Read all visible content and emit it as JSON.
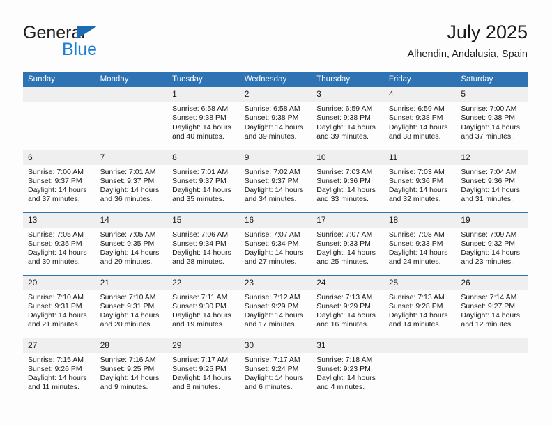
{
  "brand": {
    "line1": "General",
    "line2": "Blue",
    "triangle_color": "#1b6cb0",
    "line2_color": "#1b7ed6"
  },
  "header": {
    "title": "July 2025",
    "location": "Alhendin, Andalusia, Spain"
  },
  "theme": {
    "header_bg": "#2e74b5",
    "daynum_bg": "#efefef",
    "text": "#1a1a1a",
    "page_bg": "#fdfdfd"
  },
  "weekdays": [
    "Sunday",
    "Monday",
    "Tuesday",
    "Wednesday",
    "Thursday",
    "Friday",
    "Saturday"
  ],
  "labels": {
    "sunrise_prefix": "Sunrise:",
    "sunset_prefix": "Sunset:",
    "daylight_prefix": "Daylight:"
  },
  "weeks": [
    [
      {
        "day": "",
        "sunrise": "",
        "sunset": "",
        "daylight": ""
      },
      {
        "day": "",
        "sunrise": "",
        "sunset": "",
        "daylight": ""
      },
      {
        "day": "1",
        "sunrise": "Sunrise: 6:58 AM",
        "sunset": "Sunset: 9:38 PM",
        "daylight": "Daylight: 14 hours and 40 minutes."
      },
      {
        "day": "2",
        "sunrise": "Sunrise: 6:58 AM",
        "sunset": "Sunset: 9:38 PM",
        "daylight": "Daylight: 14 hours and 39 minutes."
      },
      {
        "day": "3",
        "sunrise": "Sunrise: 6:59 AM",
        "sunset": "Sunset: 9:38 PM",
        "daylight": "Daylight: 14 hours and 39 minutes."
      },
      {
        "day": "4",
        "sunrise": "Sunrise: 6:59 AM",
        "sunset": "Sunset: 9:38 PM",
        "daylight": "Daylight: 14 hours and 38 minutes."
      },
      {
        "day": "5",
        "sunrise": "Sunrise: 7:00 AM",
        "sunset": "Sunset: 9:38 PM",
        "daylight": "Daylight: 14 hours and 37 minutes."
      }
    ],
    [
      {
        "day": "6",
        "sunrise": "Sunrise: 7:00 AM",
        "sunset": "Sunset: 9:37 PM",
        "daylight": "Daylight: 14 hours and 37 minutes."
      },
      {
        "day": "7",
        "sunrise": "Sunrise: 7:01 AM",
        "sunset": "Sunset: 9:37 PM",
        "daylight": "Daylight: 14 hours and 36 minutes."
      },
      {
        "day": "8",
        "sunrise": "Sunrise: 7:01 AM",
        "sunset": "Sunset: 9:37 PM",
        "daylight": "Daylight: 14 hours and 35 minutes."
      },
      {
        "day": "9",
        "sunrise": "Sunrise: 7:02 AM",
        "sunset": "Sunset: 9:37 PM",
        "daylight": "Daylight: 14 hours and 34 minutes."
      },
      {
        "day": "10",
        "sunrise": "Sunrise: 7:03 AM",
        "sunset": "Sunset: 9:36 PM",
        "daylight": "Daylight: 14 hours and 33 minutes."
      },
      {
        "day": "11",
        "sunrise": "Sunrise: 7:03 AM",
        "sunset": "Sunset: 9:36 PM",
        "daylight": "Daylight: 14 hours and 32 minutes."
      },
      {
        "day": "12",
        "sunrise": "Sunrise: 7:04 AM",
        "sunset": "Sunset: 9:36 PM",
        "daylight": "Daylight: 14 hours and 31 minutes."
      }
    ],
    [
      {
        "day": "13",
        "sunrise": "Sunrise: 7:05 AM",
        "sunset": "Sunset: 9:35 PM",
        "daylight": "Daylight: 14 hours and 30 minutes."
      },
      {
        "day": "14",
        "sunrise": "Sunrise: 7:05 AM",
        "sunset": "Sunset: 9:35 PM",
        "daylight": "Daylight: 14 hours and 29 minutes."
      },
      {
        "day": "15",
        "sunrise": "Sunrise: 7:06 AM",
        "sunset": "Sunset: 9:34 PM",
        "daylight": "Daylight: 14 hours and 28 minutes."
      },
      {
        "day": "16",
        "sunrise": "Sunrise: 7:07 AM",
        "sunset": "Sunset: 9:34 PM",
        "daylight": "Daylight: 14 hours and 27 minutes."
      },
      {
        "day": "17",
        "sunrise": "Sunrise: 7:07 AM",
        "sunset": "Sunset: 9:33 PM",
        "daylight": "Daylight: 14 hours and 25 minutes."
      },
      {
        "day": "18",
        "sunrise": "Sunrise: 7:08 AM",
        "sunset": "Sunset: 9:33 PM",
        "daylight": "Daylight: 14 hours and 24 minutes."
      },
      {
        "day": "19",
        "sunrise": "Sunrise: 7:09 AM",
        "sunset": "Sunset: 9:32 PM",
        "daylight": "Daylight: 14 hours and 23 minutes."
      }
    ],
    [
      {
        "day": "20",
        "sunrise": "Sunrise: 7:10 AM",
        "sunset": "Sunset: 9:31 PM",
        "daylight": "Daylight: 14 hours and 21 minutes."
      },
      {
        "day": "21",
        "sunrise": "Sunrise: 7:10 AM",
        "sunset": "Sunset: 9:31 PM",
        "daylight": "Daylight: 14 hours and 20 minutes."
      },
      {
        "day": "22",
        "sunrise": "Sunrise: 7:11 AM",
        "sunset": "Sunset: 9:30 PM",
        "daylight": "Daylight: 14 hours and 19 minutes."
      },
      {
        "day": "23",
        "sunrise": "Sunrise: 7:12 AM",
        "sunset": "Sunset: 9:29 PM",
        "daylight": "Daylight: 14 hours and 17 minutes."
      },
      {
        "day": "24",
        "sunrise": "Sunrise: 7:13 AM",
        "sunset": "Sunset: 9:29 PM",
        "daylight": "Daylight: 14 hours and 16 minutes."
      },
      {
        "day": "25",
        "sunrise": "Sunrise: 7:13 AM",
        "sunset": "Sunset: 9:28 PM",
        "daylight": "Daylight: 14 hours and 14 minutes."
      },
      {
        "day": "26",
        "sunrise": "Sunrise: 7:14 AM",
        "sunset": "Sunset: 9:27 PM",
        "daylight": "Daylight: 14 hours and 12 minutes."
      }
    ],
    [
      {
        "day": "27",
        "sunrise": "Sunrise: 7:15 AM",
        "sunset": "Sunset: 9:26 PM",
        "daylight": "Daylight: 14 hours and 11 minutes."
      },
      {
        "day": "28",
        "sunrise": "Sunrise: 7:16 AM",
        "sunset": "Sunset: 9:25 PM",
        "daylight": "Daylight: 14 hours and 9 minutes."
      },
      {
        "day": "29",
        "sunrise": "Sunrise: 7:17 AM",
        "sunset": "Sunset: 9:25 PM",
        "daylight": "Daylight: 14 hours and 8 minutes."
      },
      {
        "day": "30",
        "sunrise": "Sunrise: 7:17 AM",
        "sunset": "Sunset: 9:24 PM",
        "daylight": "Daylight: 14 hours and 6 minutes."
      },
      {
        "day": "31",
        "sunrise": "Sunrise: 7:18 AM",
        "sunset": "Sunset: 9:23 PM",
        "daylight": "Daylight: 14 hours and 4 minutes."
      },
      {
        "day": "",
        "sunrise": "",
        "sunset": "",
        "daylight": ""
      },
      {
        "day": "",
        "sunrise": "",
        "sunset": "",
        "daylight": ""
      }
    ]
  ]
}
